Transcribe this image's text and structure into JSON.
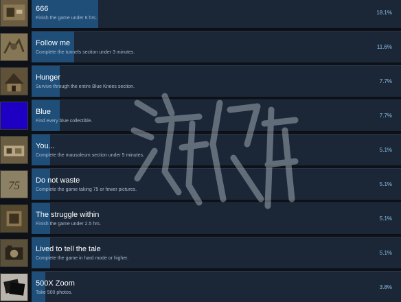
{
  "achievements": [
    {
      "title": "666",
      "description": "Finish the game under 6 hrs.",
      "percent_label": "18.1%",
      "percent": 18.1,
      "icon": "game-scene-icon"
    },
    {
      "title": "Follow me",
      "description": "Complete the tunnels section under 3 minutes.",
      "percent_label": "11.6%",
      "percent": 11.6,
      "icon": "tunnel-icon"
    },
    {
      "title": "Hunger",
      "description": "Survive through the entire Blue Knees section.",
      "percent_label": "7.7%",
      "percent": 7.7,
      "icon": "house-icon"
    },
    {
      "title": "Blue",
      "description": "Find every blue collectible.",
      "percent_label": "7.7%",
      "percent": 7.7,
      "icon": "blue-square-icon",
      "icon_color": "#1d00c4"
    },
    {
      "title": "You...",
      "description": "Complete the mausoleum section under 5 minutes.",
      "percent_label": "5.1%",
      "percent": 5.1,
      "icon": "mausoleum-icon"
    },
    {
      "title": "Do not waste",
      "description": "Complete the game taking 75 or fewer pictures.",
      "percent_label": "5.1%",
      "percent": 5.1,
      "icon": "number-75-icon",
      "icon_text": "75"
    },
    {
      "title": "The struggle within",
      "description": "Finish the game under 2.5 hrs.",
      "percent_label": "5.1%",
      "percent": 5.1,
      "icon": "box-icon"
    },
    {
      "title": "Lived to tell the tale",
      "description": "Complete the game in hard mode or higher.",
      "percent_label": "5.1%",
      "percent": 5.1,
      "icon": "camera-icon"
    },
    {
      "title": "500X Zoom",
      "description": "Take 500 photos.",
      "percent_label": "3.8%",
      "percent": 3.8,
      "icon": "photos-icon"
    }
  ],
  "colors": {
    "background": "#0e1117",
    "panel": "#1b2737",
    "progress_bar": "#1f4f79",
    "title_text": "#ffffff",
    "description_text": "#a8b8cc",
    "percent_text": "#8fc3ea"
  },
  "watermark": {
    "icon": "watermark-icon"
  }
}
